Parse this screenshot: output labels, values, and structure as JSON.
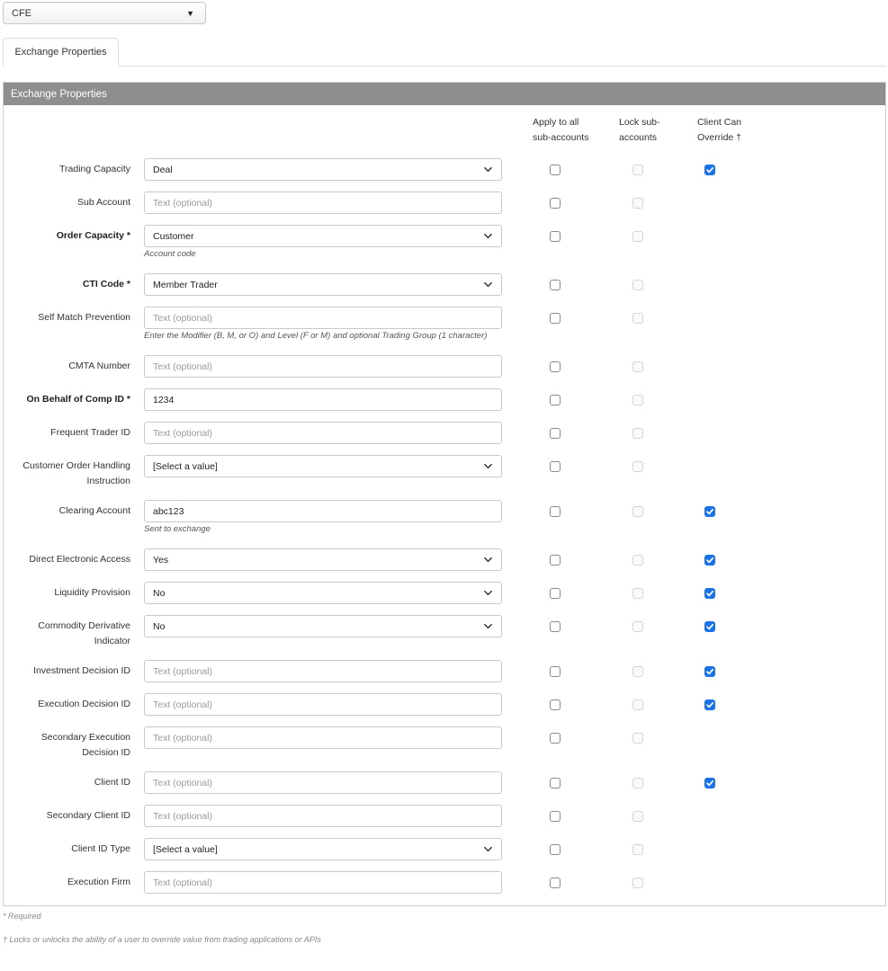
{
  "exchange_select": {
    "value": "CFE"
  },
  "tabs": [
    {
      "label": "Exchange Properties"
    }
  ],
  "panel": {
    "title": "Exchange Properties"
  },
  "columns": {
    "apply": [
      "Apply to all",
      "sub-accounts"
    ],
    "lock": [
      "Lock sub-",
      "accounts"
    ],
    "override": [
      "Client Can",
      "Override †"
    ]
  },
  "rows": [
    {
      "label": [
        "Trading Capacity"
      ],
      "bold": false,
      "type": "select",
      "value": "Deal",
      "placeholder": false,
      "hint": "",
      "apply": false,
      "override": true
    },
    {
      "label": [
        "Sub Account"
      ],
      "bold": false,
      "type": "text",
      "value": "Text (optional)",
      "placeholder": true,
      "hint": "",
      "apply": false,
      "override": false
    },
    {
      "label": [
        "Order Capacity *"
      ],
      "bold": true,
      "type": "select",
      "value": "Customer",
      "placeholder": false,
      "hint": "Account code",
      "apply": false,
      "override": false
    },
    {
      "label": [
        "CTI Code *"
      ],
      "bold": true,
      "type": "select",
      "value": "Member Trader",
      "placeholder": false,
      "hint": "",
      "apply": false,
      "override": false
    },
    {
      "label": [
        "Self Match Prevention"
      ],
      "bold": false,
      "type": "text",
      "value": "Text (optional)",
      "placeholder": true,
      "hint": "Enter the Modifier (B, M, or O) and Level (F or M) and optional Trading Group (1 character)",
      "apply": false,
      "override": false
    },
    {
      "label": [
        "CMTA Number"
      ],
      "bold": false,
      "type": "text",
      "value": "Text (optional)",
      "placeholder": true,
      "hint": "",
      "apply": false,
      "override": false
    },
    {
      "label": [
        "On Behalf of Comp ID *"
      ],
      "bold": true,
      "type": "text",
      "value": "1234",
      "placeholder": false,
      "hint": "",
      "apply": false,
      "override": false
    },
    {
      "label": [
        "Frequent Trader ID"
      ],
      "bold": false,
      "type": "text",
      "value": "Text (optional)",
      "placeholder": true,
      "hint": "",
      "apply": false,
      "override": false
    },
    {
      "label": [
        "Customer Order Handling",
        "Instruction"
      ],
      "bold": false,
      "type": "select",
      "value": "[Select a value]",
      "placeholder": false,
      "hint": "",
      "apply": false,
      "override": false
    },
    {
      "label": [
        "Clearing Account"
      ],
      "bold": false,
      "type": "text",
      "value": "abc123",
      "placeholder": false,
      "hint": "Sent to exchange",
      "apply": false,
      "override": true
    },
    {
      "label": [
        "Direct Electronic Access"
      ],
      "bold": false,
      "type": "select",
      "value": "Yes",
      "placeholder": false,
      "hint": "",
      "apply": false,
      "override": true
    },
    {
      "label": [
        "Liquidity Provision"
      ],
      "bold": false,
      "type": "select",
      "value": "No",
      "placeholder": false,
      "hint": "",
      "apply": false,
      "override": true
    },
    {
      "label": [
        "Commodity Derivative",
        "Indicator"
      ],
      "bold": false,
      "type": "select",
      "value": "No",
      "placeholder": false,
      "hint": "",
      "apply": false,
      "override": true
    },
    {
      "label": [
        "Investment Decision ID"
      ],
      "bold": false,
      "type": "text",
      "value": "Text (optional)",
      "placeholder": true,
      "hint": "",
      "apply": false,
      "override": true
    },
    {
      "label": [
        "Execution Decision ID"
      ],
      "bold": false,
      "type": "text",
      "value": "Text (optional)",
      "placeholder": true,
      "hint": "",
      "apply": false,
      "override": true
    },
    {
      "label": [
        "Secondary Execution",
        "Decision ID"
      ],
      "bold": false,
      "type": "text",
      "value": "Text (optional)",
      "placeholder": true,
      "hint": "",
      "apply": false,
      "override": false
    },
    {
      "label": [
        "Client ID"
      ],
      "bold": false,
      "type": "text",
      "value": "Text (optional)",
      "placeholder": true,
      "hint": "",
      "apply": false,
      "override": true
    },
    {
      "label": [
        "Secondary Client ID"
      ],
      "bold": false,
      "type": "text",
      "value": "Text (optional)",
      "placeholder": true,
      "hint": "",
      "apply": false,
      "override": false
    },
    {
      "label": [
        "Client ID Type"
      ],
      "bold": false,
      "type": "select",
      "value": "[Select a value]",
      "placeholder": false,
      "hint": "",
      "apply": false,
      "override": false
    },
    {
      "label": [
        "Execution Firm"
      ],
      "bold": false,
      "type": "text",
      "value": "Text (optional)",
      "placeholder": true,
      "hint": "",
      "apply": false,
      "override": false
    }
  ],
  "footnotes": {
    "required": "* Required",
    "override": "† Locks or unlocks the ability of a user to override value from trading applications or APIs"
  },
  "colors": {
    "header_bg": "#8e8e8e",
    "checkbox_checked": "#1a73e8"
  }
}
